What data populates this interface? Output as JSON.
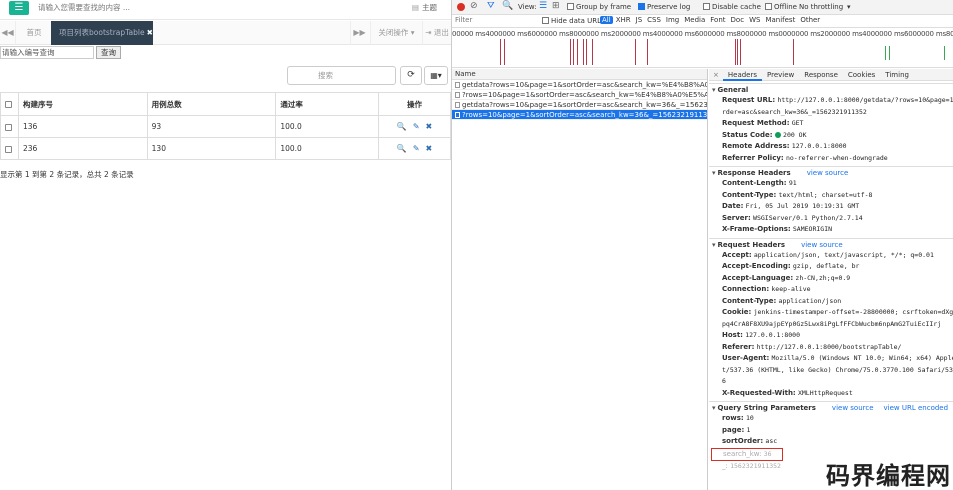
{
  "app": {
    "top_search_placeholder": "请输入您需要查找的内容 ...",
    "top_right_glyph": "▤",
    "top_right_label": "主题",
    "tabs": {
      "nav_left": "◀◀",
      "home": "首页",
      "active": "项目列表bootstrapTable",
      "active_close": "✖",
      "nav_right": "▶▶",
      "close_ops": "关闭操作 ▾",
      "logout": "⇥ 退出"
    },
    "query": {
      "input_placeholder": "请输入编号查询",
      "button": "查询"
    },
    "table_search_placeholder": "搜索",
    "refresh_glyph": "⟳",
    "columns_glyph": "▦▾",
    "table": {
      "headers": [
        "构建序号",
        "用例总数",
        "通过率",
        "操作"
      ],
      "rows": [
        {
          "id": "136",
          "total": "93",
          "rate": "100.0"
        },
        {
          "id": "236",
          "total": "130",
          "rate": "100.0"
        }
      ],
      "ops": {
        "search": "🔍",
        "edit": "✎",
        "delete": "✖"
      }
    },
    "pager_info": "显示第 1 到第 2 条记录，总共 2 条记录"
  },
  "devtools": {
    "toolbar": {
      "view": "View:",
      "group_by_frame": "Group by frame",
      "preserve_log": "Preserve log",
      "disable_cache": "Disable cache",
      "offline": "Offline",
      "throttling": "No throttling",
      "glyphs": {
        "stop": "⊘",
        "filter": "⛛",
        "search": "🔍",
        "list": "☰",
        "tree": "⊞",
        "more": "▾"
      }
    },
    "filter": {
      "placeholder": "Filter",
      "hide_data_urls": "Hide data URLs",
      "types": [
        "All",
        "XHR",
        "JS",
        "CSS",
        "Img",
        "Media",
        "Font",
        "Doc",
        "WS",
        "Manifest",
        "Other"
      ]
    },
    "timeline_labels": "00000 ms4000000 ms6000000 ms8000000 ms2000000 ms4000000 ms6000000 ms8000000 ms0000000 ms2000000 ms4000000 ms6000000 ms8000000 ms0000000 ms2000000 ms4000000 m",
    "name_header": "Name",
    "requests": [
      "getdata?rows=10&page=1&sortOrder=asc&search_kw=%E4%B8%A0%E5%A...",
      "?rows=10&page=1&sortOrder=asc&search_kw=%E4%B8%A0%E5%A5%BD&_=...",
      "getdata?rows=10&page=1&sortOrder=asc&search_kw=36&_=1562321911352",
      "?rows=10&page=1&sortOrder=asc&search_kw=36&_=1562321911352"
    ],
    "detail_tabs": [
      "×",
      "Headers",
      "Preview",
      "Response",
      "Cookies",
      "Timing"
    ],
    "general": {
      "title": "General",
      "request_url_label": "Request URL:",
      "request_url_1": "http://127.0.0.1:8000/getdata/?rows=10&page=1&sortO",
      "request_url_2": "rder=asc&search_kw=36&_=1562321911352",
      "method_label": "Request Method:",
      "method": "GET",
      "status_label": "Status Code:",
      "status": "200 OK",
      "remote_label": "Remote Address:",
      "remote": "127.0.0.1:8000",
      "referrer_label": "Referrer Policy:",
      "referrer": "no-referrer-when-downgrade"
    },
    "response_headers": {
      "title": "Response Headers",
      "view_source": "view source",
      "items": [
        {
          "k": "Content-Length:",
          "v": "91"
        },
        {
          "k": "Content-Type:",
          "v": "text/html; charset=utf-8"
        },
        {
          "k": "Date:",
          "v": "Fri, 05 Jul 2019 10:19:31 GMT"
        },
        {
          "k": "Server:",
          "v": "WSGIServer/0.1 Python/2.7.14"
        },
        {
          "k": "X-Frame-Options:",
          "v": "SAMEORIGIN"
        }
      ]
    },
    "request_headers": {
      "title": "Request Headers",
      "view_source": "view source",
      "accept_k": "Accept:",
      "accept_v": "application/json, text/javascript, */*; q=0.01",
      "enc_k": "Accept-Encoding:",
      "enc_v": "gzip, deflate, br",
      "lang_k": "Accept-Language:",
      "lang_v": "zh-CN,zh;q=0.9",
      "conn_k": "Connection:",
      "conn_v": "keep-alive",
      "ctype_k": "Content-Type:",
      "ctype_v": "application/json",
      "cookie_k": "Cookie:",
      "cookie_v1": "jenkins-timestamper-offset=-28800000; csrftoken=dXgAxru",
      "cookie_v2": "pq4CrA8F8XU9ajpEYp0Gz5Lwx8iPgLfFFCbWucbm6npAmG2TuiEcIIrj",
      "host_k": "Host:",
      "host_v": "127.0.0.1:8000",
      "ref_k": "Referer:",
      "ref_v": "http://127.0.0.1:8000/bootstrapTable/",
      "ua_k": "User-Agent:",
      "ua_v1": "Mozilla/5.0 (Windows NT 10.0; Win64; x64) AppleWebK",
      "ua_v2": "t/537.36 (KHTML, like Gecko) Chrome/75.0.3770.100 Safari/537.3",
      "ua_v3": "6",
      "xrw_k": "X-Requested-With:",
      "xrw_v": "XMLHttpRequest"
    },
    "query_params": {
      "title": "Query String Parameters",
      "view_source": "view source",
      "view_url_encoded": "view URL encoded",
      "rows_k": "rows:",
      "rows_v": "10",
      "page_k": "page:",
      "page_v": "1",
      "sort_k": "sortOrder:",
      "sort_v": "asc",
      "kw_k": "search_kw:",
      "kw_v": "36",
      "ts_k": "_:",
      "ts_v": "1562321911352"
    }
  },
  "watermark": "码界编程网"
}
